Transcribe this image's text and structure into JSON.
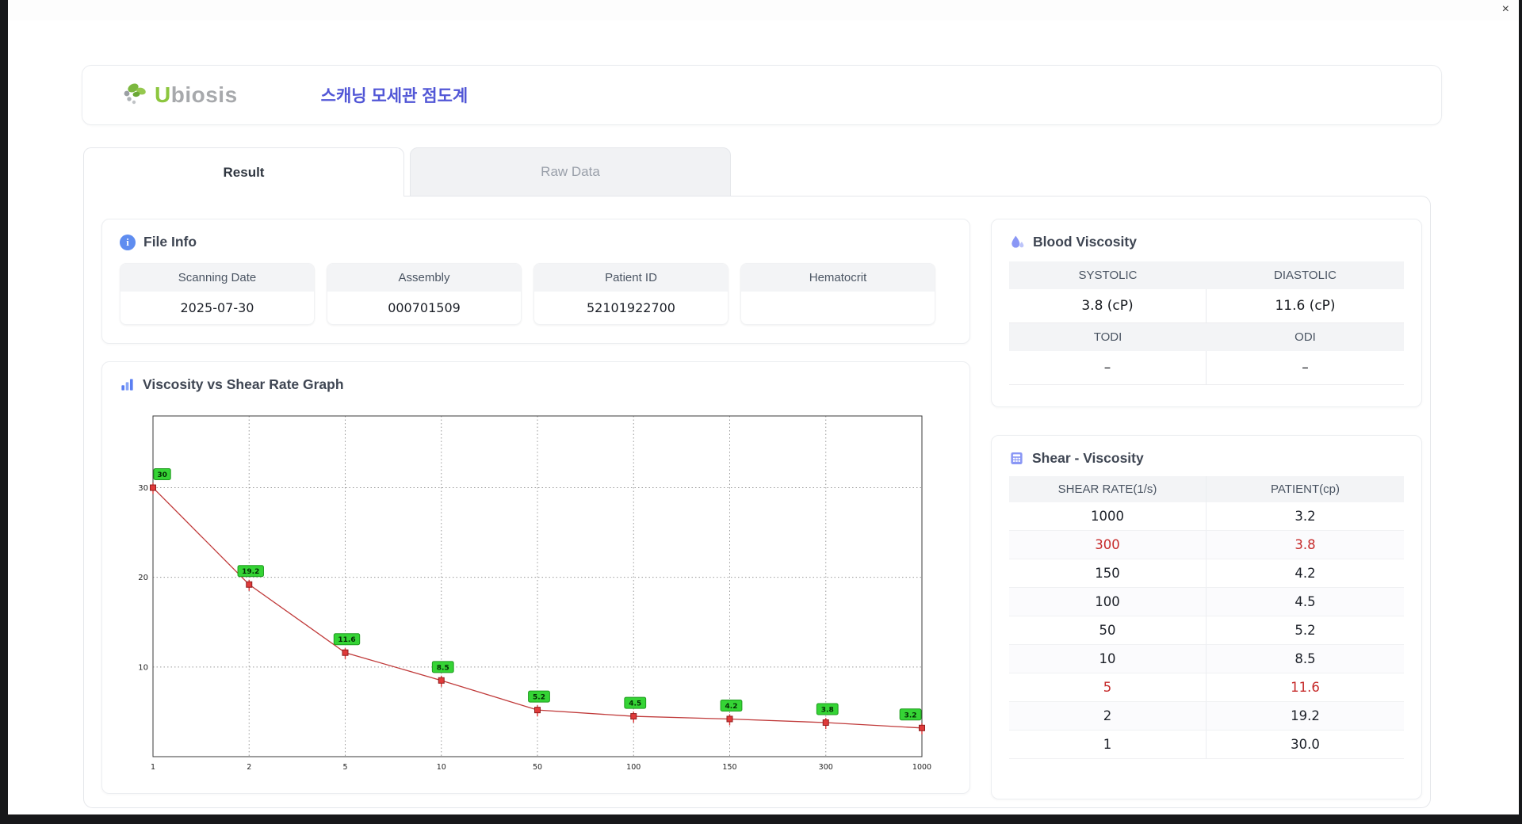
{
  "window": {
    "close_glyph": "×"
  },
  "header": {
    "logo": {
      "leading": "U",
      "rest": "biosis"
    },
    "title": "스캐닝 모세관 점도계"
  },
  "tabs": {
    "result": "Result",
    "raw_data": "Raw Data"
  },
  "file_info": {
    "title": "File Info",
    "info_glyph": "i",
    "fields": [
      {
        "label": "Scanning Date",
        "value": "2025-07-30"
      },
      {
        "label": "Assembly",
        "value": "000701509"
      },
      {
        "label": "Patient ID",
        "value": "52101922700"
      },
      {
        "label": "Hematocrit",
        "value": ""
      }
    ]
  },
  "graph_section": {
    "title": "Viscosity vs Shear Rate Graph"
  },
  "blood_viscosity": {
    "title": "Blood Viscosity",
    "rows": [
      {
        "headers": [
          "SYSTOLIC",
          "DIASTOLIC"
        ],
        "values": [
          "3.8 (cP)",
          "11.6 (cP)"
        ]
      },
      {
        "headers": [
          "TODI",
          "ODI"
        ],
        "values": [
          "–",
          "–"
        ]
      }
    ]
  },
  "shear_viscosity": {
    "title": "Shear - Viscosity",
    "columns": [
      "SHEAR RATE(1/s)",
      "PATIENT(cp)"
    ],
    "rows": [
      {
        "rate": "1000",
        "patient": "3.2",
        "highlight": false
      },
      {
        "rate": "300",
        "patient": "3.8",
        "highlight": true
      },
      {
        "rate": "150",
        "patient": "4.2",
        "highlight": false
      },
      {
        "rate": "100",
        "patient": "4.5",
        "highlight": false
      },
      {
        "rate": "50",
        "patient": "5.2",
        "highlight": false
      },
      {
        "rate": "10",
        "patient": "8.5",
        "highlight": false
      },
      {
        "rate": "5",
        "patient": "11.6",
        "highlight": true
      },
      {
        "rate": "2",
        "patient": "19.2",
        "highlight": false
      },
      {
        "rate": "1",
        "patient": "30.0",
        "highlight": false
      }
    ]
  },
  "chart_data": {
    "type": "line",
    "title": "Viscosity vs Shear Rate Graph",
    "x_labels": [
      "1",
      "2",
      "5",
      "10",
      "50",
      "100",
      "150",
      "300",
      "1000"
    ],
    "values": [
      30,
      19.2,
      11.6,
      8.5,
      5.2,
      4.5,
      4.2,
      3.8,
      3.2
    ],
    "point_labels": [
      "30",
      "19.2",
      "11.6",
      "8.5",
      "5.2",
      "4.5",
      "4.2",
      "3.8",
      "3.2"
    ],
    "xlabel": "",
    "ylabel": "",
    "y_ticks": [
      10,
      20,
      30
    ],
    "ylim": [
      0,
      38
    ],
    "x_scale": "categorical (log-spaced shear rates)",
    "grid": "dotted",
    "grid_color": "#9a9a9a",
    "frame_color": "#3a3a3a",
    "line_color": "#c03a3a",
    "marker_color": "#e03a3a",
    "marker_edge_color": "#8f1f1f",
    "label_bg": "#35d435",
    "label_border": "#1e9a1e",
    "label_text_color": "#042d04"
  },
  "colors": {
    "accent_blue": "#5156d6",
    "icon_blue": "#8a97f5",
    "logo_green": "#8cc63e",
    "logo_gray": "#a7a9ac",
    "highlight_red": "#c62a2a",
    "header_cell_bg": "#f3f4f6"
  }
}
